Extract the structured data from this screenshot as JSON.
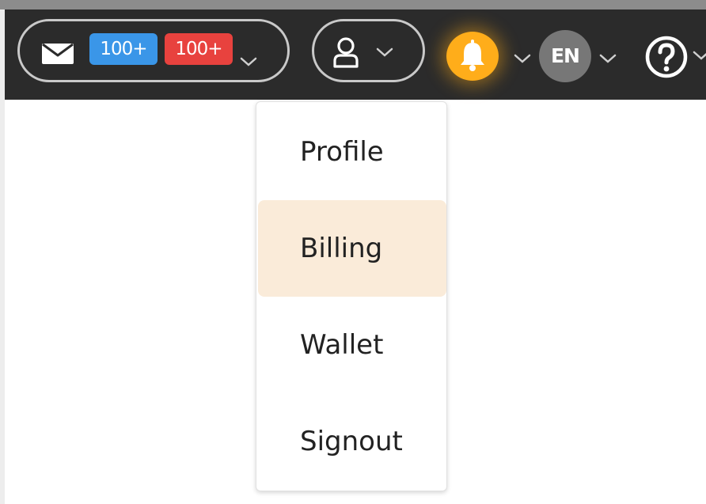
{
  "header": {
    "messages": {
      "icon": "envelope-icon",
      "badges": [
        {
          "label": "100+",
          "color": "#3a96e8"
        },
        {
          "label": "100+",
          "color": "#e8423e"
        }
      ]
    },
    "user_menu": {
      "icon": "user-icon"
    },
    "notifications": {
      "icon": "bell-icon",
      "color": "#ffad1a"
    },
    "language": {
      "label": "EN"
    },
    "help": {
      "icon": "question-circle-icon"
    }
  },
  "dropdown": {
    "items": [
      {
        "label": "Profile",
        "active": false
      },
      {
        "label": "Billing",
        "active": true
      },
      {
        "label": "Wallet",
        "active": false
      },
      {
        "label": "Signout",
        "active": false
      }
    ],
    "highlight_color": "#faebd9"
  }
}
